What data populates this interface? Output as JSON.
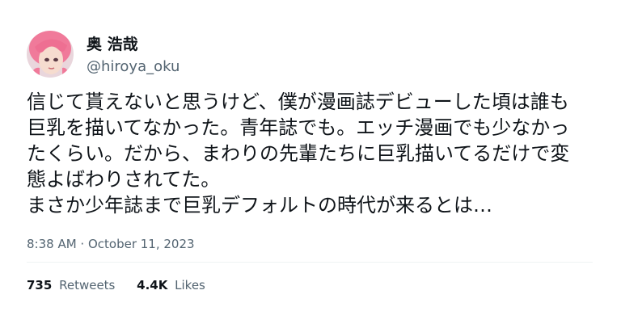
{
  "author": {
    "display_name": "奥 浩哉",
    "handle": "@hiroya_oku"
  },
  "tweet": {
    "lines": [
      "信じて貰えないと思うけど、僕が漫画誌デビューした頃は誰も",
      "巨乳を描いてなかった。青年誌でも。エッチ漫画でも少なかっ",
      "たくらい。だから、まわりの先輩たちに巨乳描いてるだけで変",
      "態よばわりされてた。",
      "まさか少年誌まで巨乳デフォルトの時代が来るとは…"
    ],
    "timestamp": "8:38 AM · October 11, 2023"
  },
  "stats": {
    "retweets_count": "735",
    "retweets_label": "Retweets",
    "likes_count": "4.4K",
    "likes_label": "Likes"
  },
  "colors": {
    "text_primary": "#0f1419",
    "text_secondary": "#536471",
    "avatar_hair": "#f07a9a"
  }
}
